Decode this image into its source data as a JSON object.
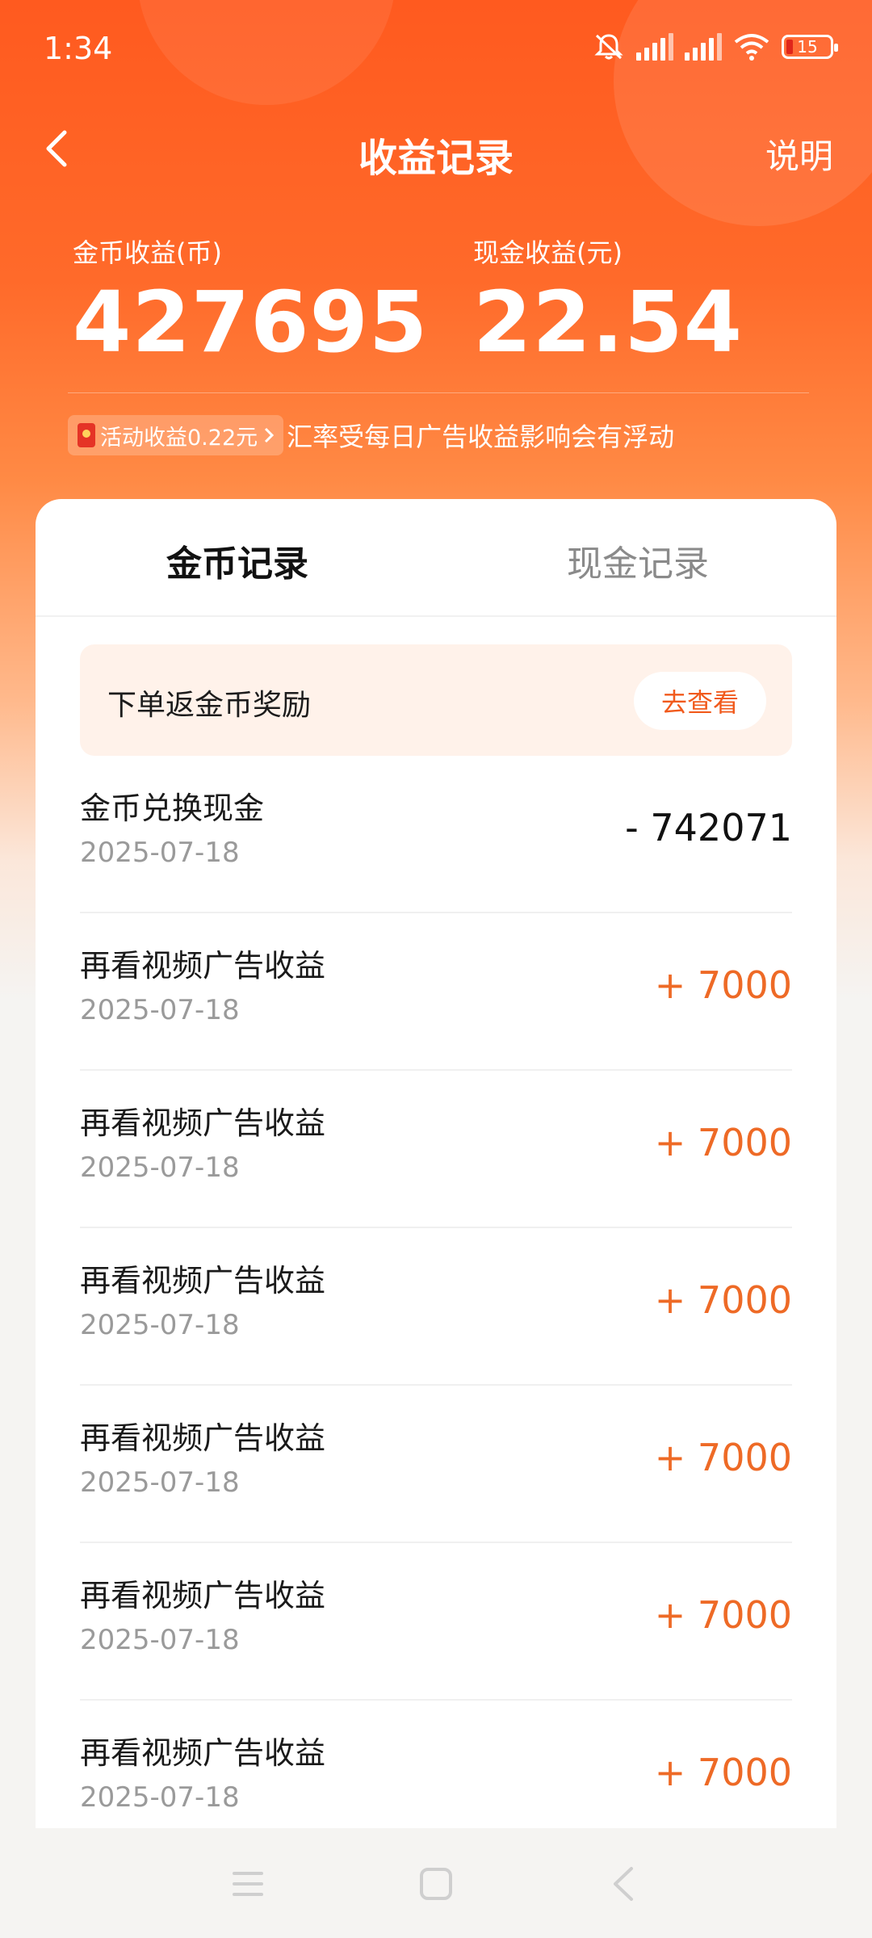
{
  "status_bar": {
    "time": "1:34",
    "battery": "15"
  },
  "nav": {
    "title": "收益记录",
    "help": "说明"
  },
  "summary": {
    "coin_label": "金币收益(币)",
    "coin_value": "427695",
    "cash_label": "现金收益(元)",
    "cash_value": "22.54"
  },
  "notice": {
    "activity": "活动收益0.22元",
    "text": "汇率受每日广告收益影响会有浮动"
  },
  "tabs": [
    {
      "label": "金币记录",
      "active": true
    },
    {
      "label": "现金记录",
      "active": false
    }
  ],
  "promo": {
    "text": "下单返金币奖励",
    "button": "去查看"
  },
  "records": [
    {
      "title": "金币兑换现金",
      "date": "2025-07-18",
      "amount": "- 742071",
      "type": "neg"
    },
    {
      "title": "再看视频广告收益",
      "date": "2025-07-18",
      "amount": "+ 7000",
      "type": "pos"
    },
    {
      "title": "再看视频广告收益",
      "date": "2025-07-18",
      "amount": "+ 7000",
      "type": "pos"
    },
    {
      "title": "再看视频广告收益",
      "date": "2025-07-18",
      "amount": "+ 7000",
      "type": "pos"
    },
    {
      "title": "再看视频广告收益",
      "date": "2025-07-18",
      "amount": "+ 7000",
      "type": "pos"
    },
    {
      "title": "再看视频广告收益",
      "date": "2025-07-18",
      "amount": "+ 7000",
      "type": "pos"
    },
    {
      "title": "再看视频广告收益",
      "date": "2025-07-18",
      "amount": "+ 7000",
      "type": "pos"
    }
  ],
  "colors": {
    "brand": "#ff5a1f",
    "positive": "#ee6a26",
    "promo_bg": "#fff2ea"
  }
}
